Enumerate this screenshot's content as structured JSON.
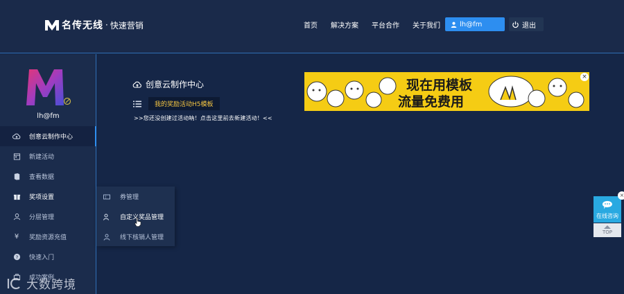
{
  "header": {
    "brand_name": "名传无线",
    "brand_sep": "·",
    "brand_slogan": "快速营销",
    "nav": [
      "首页",
      "解决方案",
      "平台合作",
      "关于我们"
    ],
    "user_label": "lh@fm",
    "logout_label": "退出"
  },
  "sidebar": {
    "username": "lh@fm",
    "items": [
      {
        "label": "创意云制作中心",
        "icon": "cloud-upload-icon"
      },
      {
        "label": "新建活动",
        "icon": "calendar-icon"
      },
      {
        "label": "查看数据",
        "icon": "book-icon"
      },
      {
        "label": "奖项设置",
        "icon": "gift-icon"
      },
      {
        "label": "分层管理",
        "icon": "layers-icon"
      },
      {
        "label": "奖励资源充值",
        "icon": "yen-icon"
      },
      {
        "label": "快速入门",
        "icon": "question-icon"
      },
      {
        "label": "成功案例",
        "icon": "case-icon"
      }
    ]
  },
  "submenu": {
    "items": [
      {
        "label": "券管理",
        "icon": "ticket-icon"
      },
      {
        "label": "自定义奖品管理",
        "icon": "user-edit-icon"
      },
      {
        "label": "线下核销人管理",
        "icon": "person-icon"
      }
    ]
  },
  "main": {
    "title": "创意云制作中心",
    "template_tag": "我的奖励活动H5模板",
    "notice": ">>您还没创建过活动呐！点击这里前去新建活动！<<"
  },
  "banner": {
    "line1": "现在用模板",
    "line2": "流量免费用",
    "close": "×"
  },
  "float": {
    "close": "×",
    "consult_label": "在线咨询",
    "top_label": "TOP"
  },
  "watermark": {
    "text": "大数跨境"
  },
  "colors": {
    "background": "#152647",
    "accent": "#2d8ef0",
    "tag_text": "#f4c542",
    "banner": "#f5cc14",
    "float_consult": "#29a9e1"
  }
}
